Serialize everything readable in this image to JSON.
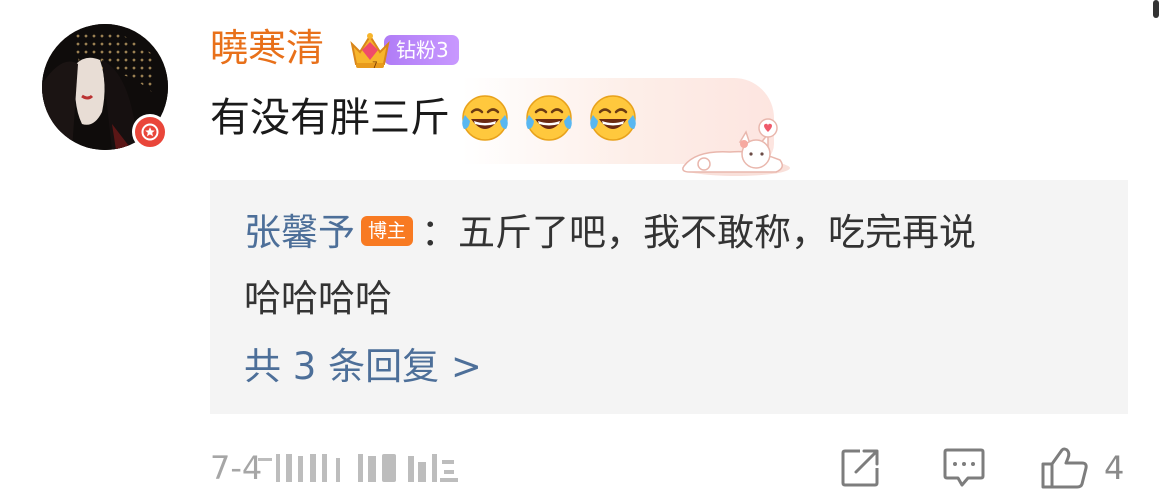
{
  "comment": {
    "username": "曉寒清",
    "fan_badge_label": "钻粉3",
    "text": "有没有胖三斤",
    "emoji_icons": [
      "laugh-cry-icon",
      "laugh-cry-icon",
      "laugh-cry-icon"
    ],
    "timestamp": "7-4",
    "like_count": "4"
  },
  "reply": {
    "author": "张馨予",
    "author_tag": "博主",
    "separator": "：",
    "line1": "五斤了吧，我不敢称，吃完再说",
    "line2": "哈哈哈哈",
    "more_label": "共 3 条回复 >"
  },
  "icons": {
    "share": "share-icon",
    "reply": "comment-icon",
    "like": "thumbs-up-icon",
    "vip": "star-badge-icon",
    "crown": "crown-icon"
  },
  "colors": {
    "username": "#e8701a",
    "link_blue": "#4d6f99",
    "blogger_tag": "#f87a22",
    "fan_badge": "#b07cf6",
    "vip_badge": "#e9463a",
    "reply_bg": "#f4f4f4",
    "muted": "#a6a6a6"
  }
}
